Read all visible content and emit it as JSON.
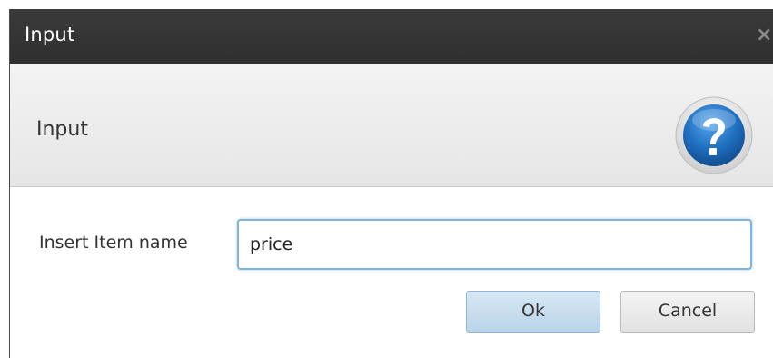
{
  "window": {
    "title": "Input",
    "close_glyph": "×"
  },
  "header": {
    "title": "Input",
    "icon": "question-help-icon"
  },
  "form": {
    "label": "Insert Item name",
    "value": "price"
  },
  "buttons": {
    "ok_label": "Ok",
    "cancel_label": "Cancel"
  },
  "colors": {
    "titlebar": "#333333",
    "help_icon": "#1f6fc0",
    "input_focus_border": "#7fb4dd",
    "ok_button": "#c6ddef"
  }
}
